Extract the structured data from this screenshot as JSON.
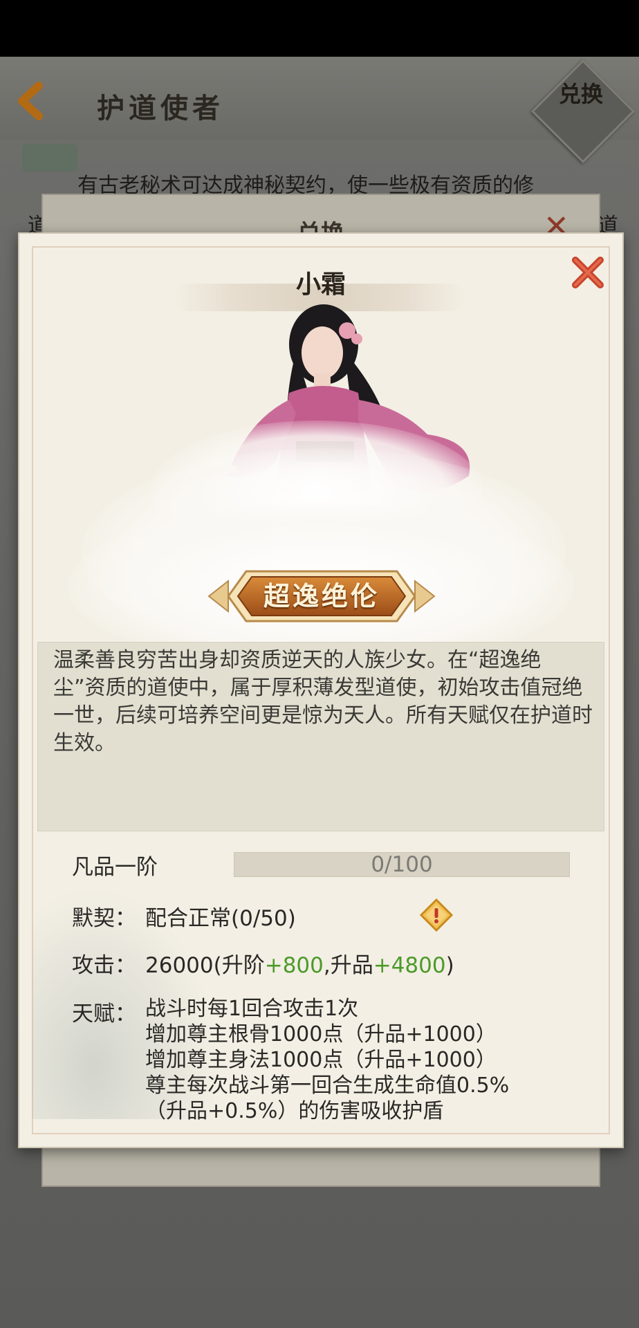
{
  "background": {
    "title": "护道使者",
    "redeem_label": "兑换",
    "intro_line1": "有古老秘术可达成神秘契约，使一些极有资质的修",
    "intro_line2_left": "道",
    "intro_line2_right": "道",
    "behind_panel_title": "兑换"
  },
  "panel": {
    "name": "小霜",
    "rank_label": "超逸绝伦",
    "description": "温柔善良穷苦出身却资质逆天的人族少女。在“超逸绝尘”资质的道使中，属于厚积薄发型道使，初始攻击值冠绝一世，后续可培养空间更是惊为天人。所有天赋仅在护道时生效。",
    "grade": {
      "label": "凡品一阶",
      "progress_text": "0/100",
      "progress_fraction": 0
    },
    "bond": {
      "label": "默契：",
      "value": "配合正常(0/50)"
    },
    "attack": {
      "label": "攻击：",
      "base": "26000(升阶",
      "stage_bonus": "+800",
      "mid": ",升品",
      "grade_bonus": "+4800",
      "end": ")"
    },
    "talent": {
      "label": "天赋：",
      "lines": [
        "战斗时每1回合攻击1次",
        "增加尊主根骨1000点（升品+1000）",
        "增加尊主身法1000点（升品+1000）",
        "尊主每次战斗第一回合生成生命值0.5%",
        "（升品+0.5%）的伤害吸收护盾"
      ]
    }
  },
  "colors": {
    "accent_green": "#4c9a2a",
    "close_red": "#c8452c",
    "badge_orange": "#b5611f"
  }
}
